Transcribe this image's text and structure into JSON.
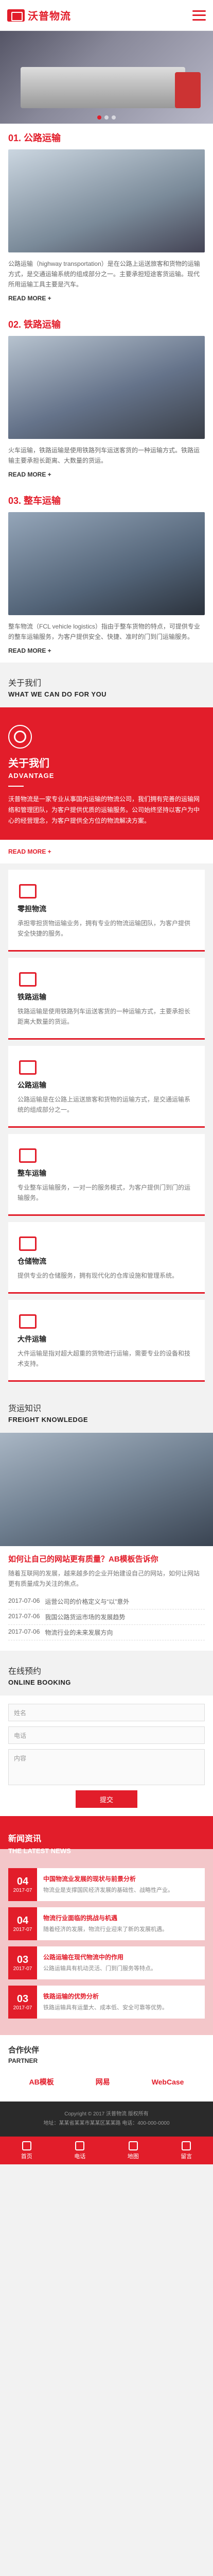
{
  "header": {
    "logo_text": "沃普物流"
  },
  "sections": [
    {
      "title": "01. 公路运输",
      "desc": "公路运输（highway transportation）是在公路上运送旅客和货物的运输方式，是交通运输系统的组成部分之一。主要承担短途客货运输。现代所用运输工具主要是汽车。",
      "more": "READ MORE +"
    },
    {
      "title": "02. 铁路运输",
      "desc": "火车运输，铁路运输是使用铁路列车运送客货的一种运输方式。铁路运输主要承担长距离、大数量的货运。",
      "more": "READ MORE +"
    },
    {
      "title": "03. 整车运输",
      "desc": "整车物流（FCL vehicle logistics）指由于整车货物的特点，可提供专业的整车运输服务，为客户提供安全、快捷、准时的门到门运输服务。",
      "more": "READ MORE +"
    }
  ],
  "about": {
    "title_cn": "关于我们",
    "title_en": "WHAT WE CAN DO FOR YOU",
    "heading": "关于我们",
    "heading_en": "ADVANTAGE",
    "text": "沃普物流是一家专业从事国内运输的物流公司，我们拥有完善的运输网络和管理团队，为客户提供优质的运输服务。公司始终坚持以客户为中心的经营理念，为客户提供全方位的物流解决方案。",
    "more": "READ MORE +"
  },
  "services": [
    {
      "title": "零担物流",
      "text": "承担零担货物运输业务，拥有专业的物流运输团队，为客户提供安全快捷的服务。"
    },
    {
      "title": "铁路运输",
      "text": "铁路运输是使用铁路列车运送客货的一种运输方式，主要承担长距离大数量的货运。"
    },
    {
      "title": "公路运输",
      "text": "公路运输是在公路上运送旅客和货物的运输方式，是交通运输系统的组成部分之一。"
    },
    {
      "title": "整车运输",
      "text": "专业整车运输服务，一对一的服务模式，为客户提供门到门的运输服务。"
    },
    {
      "title": "仓储物流",
      "text": "提供专业的仓储服务，拥有现代化的仓库设施和管理系统。"
    },
    {
      "title": "大件运输",
      "text": "大件运输是指对超大超重的货物进行运输，需要专业的设备和技术支持。"
    }
  ],
  "knowledge": {
    "title_cn": "货运知识",
    "title_en": "FREIGHT KNOWLEDGE",
    "headline": "如何让自己的网站更有质量？AB模板告诉你",
    "desc": "随着互联网的发展，越来越多的企业开始建设自己的网站，如何让网站更有质量成为关注的焦点。",
    "items": [
      {
        "date": "2017-07-06",
        "text": "运营公司的价格定义与“以”意外"
      },
      {
        "date": "2017-07-06",
        "text": "我国公路货运市场的发展趋势"
      },
      {
        "date": "2017-07-06",
        "text": "物流行业的未来发展方向"
      }
    ]
  },
  "booking": {
    "title_cn": "在线预约",
    "title_en": "ONLINE BOOKING",
    "name_ph": "姓名",
    "phone_ph": "电话",
    "content_ph": "内容",
    "submit": "提交"
  },
  "news": {
    "title_cn": "新闻资讯",
    "title_en": "THE LATEST NEWS",
    "items": [
      {
        "day": "04",
        "ym": "2017-07",
        "title": "中国物流业发展的现状与前景分析",
        "text": "物流业是支撑国民经济发展的基础性、战略性产业。"
      },
      {
        "day": "04",
        "ym": "2017-07",
        "title": "物流行业面临的挑战与机遇",
        "text": "随着经济的发展，物流行业迎来了新的发展机遇。"
      },
      {
        "day": "03",
        "ym": "2017-07",
        "title": "公路运输在现代物流中的作用",
        "text": "公路运输具有机动灵活、门到门服务等特点。"
      },
      {
        "day": "03",
        "ym": "2017-07",
        "title": "铁路运输的优势分析",
        "text": "铁路运输具有运量大、成本低、安全可靠等优势。"
      }
    ]
  },
  "partners": {
    "title_cn": "合作伙伴",
    "title_en": "PARTNER",
    "logos": [
      "AB模板",
      "网易",
      "WebCase"
    ]
  },
  "footer": {
    "line1": "Copyright © 2017 沃普物流 版权所有",
    "line2": "地址：某某省某某市某某区某某路 电话：400-000-0000"
  },
  "tabbar": [
    "首页",
    "电话",
    "地图",
    "留言"
  ]
}
